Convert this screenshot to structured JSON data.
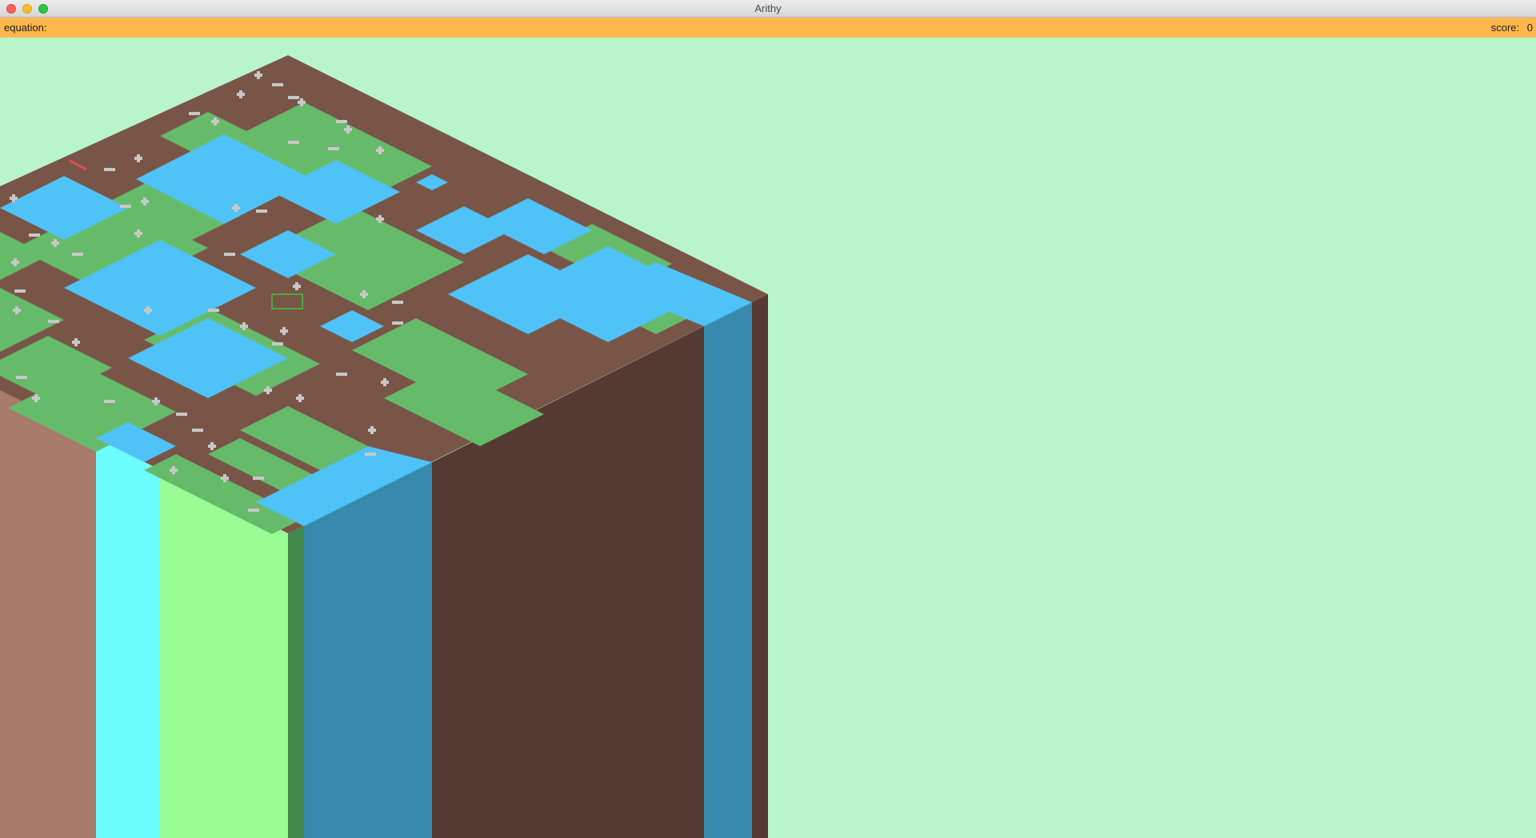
{
  "window": {
    "title": "Arithy"
  },
  "status": {
    "equation_label": "equation:",
    "equation_value": "",
    "score_label": "score:",
    "score_value": "0"
  },
  "colors": {
    "background": "#b9f5ca",
    "status_bar": "#ffb74d",
    "dirt_top": "#795548",
    "dirt_side_dark": "#553a31",
    "dirt_side_light": "#a87a6a",
    "grass_top": "#66bb6a",
    "grass_side_light": "#98fd94",
    "grass_side_dark": "#43874a",
    "water_top": "#4fc3f7",
    "water_side_light": "#6bfdfd",
    "water_side_dark": "#3789ad",
    "operator_tile": "#c8c8c8"
  },
  "board": {
    "columns": [
      "dirt",
      "water",
      "grass",
      "grass-dark",
      "water-dark",
      "dirt-dark",
      "water-dark",
      "dirt-dark"
    ],
    "cursor": "selection-cursor",
    "operators": [
      "+",
      "−",
      "×",
      "÷"
    ]
  }
}
